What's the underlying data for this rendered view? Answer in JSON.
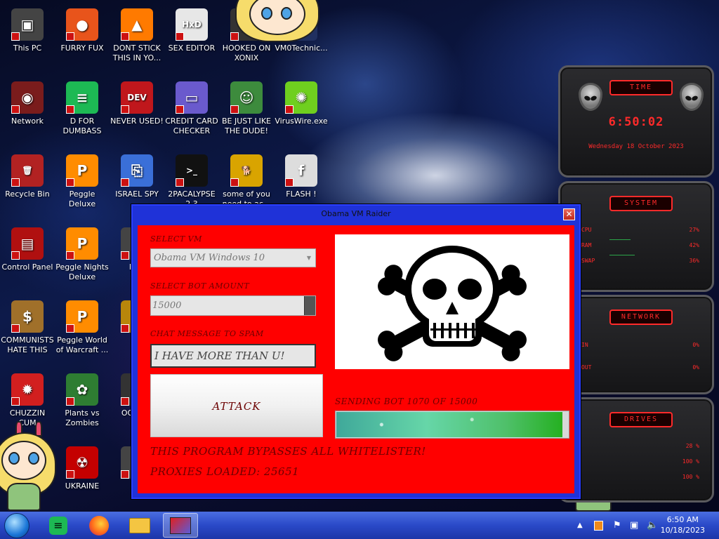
{
  "desktop": {
    "icons": [
      {
        "label": "This PC",
        "color": "#444444",
        "glyph": "▣"
      },
      {
        "label": "FURRY FUX",
        "color": "#e8541b",
        "glyph": "●"
      },
      {
        "label": "DONT STICK THIS IN YO...",
        "color": "#ff7a00",
        "glyph": "▲"
      },
      {
        "label": "SEX EDITOR",
        "color": "#e7e7e7",
        "glyph": "HxD"
      },
      {
        "label": "HOOKED ON XONIX",
        "color": "#333333",
        "glyph": "▦"
      },
      {
        "label": "VM0Technic...",
        "color": "#203060",
        "glyph": "★"
      },
      {
        "label": "Network",
        "color": "#7a1c1c",
        "glyph": "◉"
      },
      {
        "label": "D FOR DUMBASS",
        "color": "#1db954",
        "glyph": "≡"
      },
      {
        "label": "NEVER USED!",
        "color": "#c0171c",
        "glyph": "DEV"
      },
      {
        "label": "CREDIT CARD CHECKER",
        "color": "#6a5acd",
        "glyph": "▭"
      },
      {
        "label": "BE JUST LIKE THE DUDE!",
        "color": "#3d8b3d",
        "glyph": "☺"
      },
      {
        "label": "VirusWire.exe",
        "color": "#6fcf1f",
        "glyph": "✺"
      },
      {
        "label": "Recycle Bin",
        "color": "#b22222",
        "glyph": "🗑"
      },
      {
        "label": "Peggle Deluxe",
        "color": "#ff8c00",
        "glyph": "P"
      },
      {
        "label": "ISRAEL SPY",
        "color": "#3a6fd8",
        "glyph": "⎘"
      },
      {
        "label": "2PACALYPSE 2.3",
        "color": "#111111",
        "glyph": ">_"
      },
      {
        "label": "some of you need to ac...",
        "color": "#d9a400",
        "glyph": "🐕"
      },
      {
        "label": "FLASH !",
        "color": "#dddddd",
        "glyph": "f"
      },
      {
        "label": "Control Panel",
        "color": "#b01010",
        "glyph": "▤"
      },
      {
        "label": "Peggle Nights Deluxe",
        "color": "#ff8c00",
        "glyph": "P"
      },
      {
        "label": "DEE",
        "color": "#444444",
        "glyph": "▮"
      },
      {
        "label": "COMMUNISTS HATE THIS G...",
        "color": "#a0702a",
        "glyph": "$"
      },
      {
        "label": "Peggle World of Warcraft ...",
        "color": "#ff8c00",
        "glyph": "P"
      },
      {
        "label": "DIE",
        "color": "#b8860b",
        "glyph": "▮"
      },
      {
        "label": "CHUZZIN CUM",
        "color": "#d21f1f",
        "glyph": "✹"
      },
      {
        "label": "Plants vs Zombies",
        "color": "#2e7d32",
        "glyph": "✿"
      },
      {
        "label": "OOF DO",
        "color": "#333333",
        "glyph": "☻"
      },
      {
        "label": "load Ali...",
        "color": "#8a2be2",
        "glyph": "⬇"
      },
      {
        "label": "UKRAINE",
        "color": "#c40000",
        "glyph": "☢"
      },
      {
        "label": "C",
        "color": "#444444",
        "glyph": "▮"
      }
    ]
  },
  "gadgets": {
    "time": {
      "title": "TIME",
      "clock": "6:50:02",
      "date": "Wednesday 18 October 2023"
    },
    "system": {
      "title": "SYSTEM",
      "rows": [
        {
          "label": "CPU",
          "value": "27%"
        },
        {
          "label": "RAM",
          "value": "42%"
        },
        {
          "label": "SWAP",
          "value": "36%"
        }
      ]
    },
    "network": {
      "title": "NETWORK",
      "rows": [
        {
          "label": "IN",
          "value": "0%"
        },
        {
          "label": "OUT",
          "value": "0%"
        }
      ]
    },
    "drives": {
      "title": "DRIVES",
      "rows": [
        {
          "label": "",
          "value": "28 %"
        },
        {
          "label": "",
          "value": "100 %"
        },
        {
          "label": "",
          "value": "100 %"
        }
      ]
    }
  },
  "window": {
    "title": "Obama VM Raider",
    "close_glyph": "✕",
    "vm_label": "SELECT VM",
    "vm_value": "Obama VM Windows 10",
    "bot_label": "SELECT BOT AMOUNT",
    "bot_value": "15000",
    "msg_label": "CHAT MESSAGE TO SPAM",
    "msg_value": "I HAVE MORE THAN U!",
    "attack_label": "ATTACK",
    "status": "SENDING BOT 1070 OF 15000",
    "progress_fraction": 0.97,
    "bypass_text": "THIS PROGRAM BYPASSES ALL WHITELISTER!",
    "proxies_text": "PROXIES LOADED: 25651",
    "colors": {
      "frame": "#1f32d8",
      "client": "#ff0000",
      "label": "#6b0000"
    }
  },
  "taskbar": {
    "buttons": [
      "start-orb",
      "spotify-icon",
      "firefox-icon",
      "file-explorer-icon",
      "vm-raider-icon"
    ],
    "tray": [
      "show-hidden-icons",
      "notification-icon",
      "action-center-flag",
      "network-icon",
      "volume-icon"
    ],
    "time": "6:50 AM",
    "date": "10/18/2023"
  }
}
